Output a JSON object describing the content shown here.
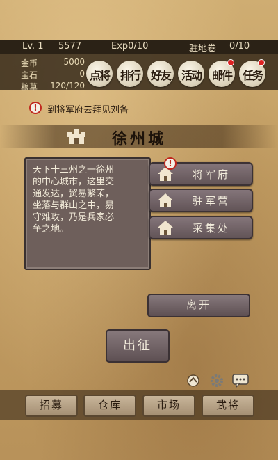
{
  "player": {
    "level": "Lv. 1",
    "power": "5577",
    "exp": "Exp0/10",
    "garrison_label": "驻地卷",
    "garrison_value": "0/10"
  },
  "resources": [
    {
      "label": "金币",
      "value": "5000"
    },
    {
      "label": "宝石",
      "value": "0"
    },
    {
      "label": "粮草",
      "value": "120/120"
    }
  ],
  "menu": [
    {
      "label": "点将",
      "badge": false
    },
    {
      "label": "排行",
      "badge": false
    },
    {
      "label": "好友",
      "badge": false
    },
    {
      "label": "活动",
      "badge": false
    },
    {
      "label": "邮件",
      "badge": true
    },
    {
      "label": "任务",
      "badge": true
    }
  ],
  "tip": "到将军府去拜见刘备",
  "city": {
    "name": "徐州城",
    "lines": [
      "天下十三州之一徐州",
      "的中心城市，这里交",
      "通发达，贸易繁荣，",
      "坐落与群山之中，易",
      "守难攻，乃是兵家必",
      "争之地。"
    ]
  },
  "buildings": [
    {
      "label": "将军府",
      "alert": true
    },
    {
      "label": "驻军营",
      "alert": false
    },
    {
      "label": "采集处",
      "alert": false
    }
  ],
  "leave_label": "离开",
  "campaign_label": "出征",
  "tabs": [
    "招募",
    "仓库",
    "市场",
    "武将"
  ],
  "colors": {
    "accent_red": "#c0281e",
    "panel": "#6e5f5b",
    "bar": "#2b2216"
  }
}
